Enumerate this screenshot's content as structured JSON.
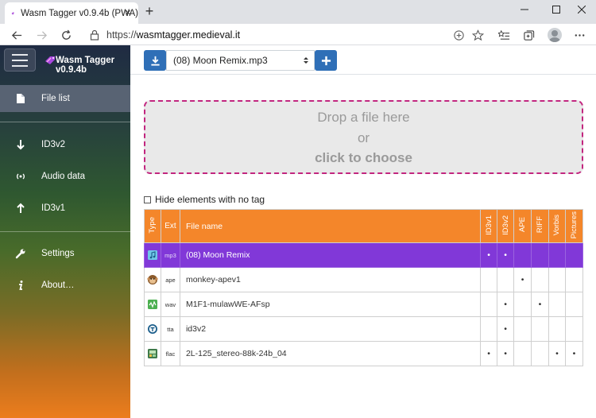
{
  "browser": {
    "tab_title": "Wasm Tagger v0.9.4b (PWA)",
    "url_scheme": "https://",
    "url_host": "wasmtagger.medieval.it"
  },
  "app": {
    "title": "Wasm Tagger v0.9.4b"
  },
  "sidebar": {
    "items": [
      {
        "label": "File list",
        "icon": "file-icon",
        "active": true
      },
      {
        "label": "ID3v2",
        "icon": "arrow-down-icon"
      },
      {
        "label": "Audio data",
        "icon": "broadcast-icon"
      },
      {
        "label": "ID3v1",
        "icon": "arrow-up-icon"
      },
      {
        "label": "Settings",
        "icon": "wrench-icon"
      },
      {
        "label": "About…",
        "icon": "info-icon"
      }
    ]
  },
  "toolbar": {
    "selected_file": "(08) Moon Remix.mp3"
  },
  "dropzone": {
    "line1": "Drop a file here",
    "line2": "or",
    "line3": "click to choose"
  },
  "filter": {
    "hide_label": "Hide elements with no tag",
    "checked": false
  },
  "table": {
    "headers": {
      "type": "Type",
      "ext": "Ext",
      "name": "File name",
      "id3v1": "ID3v1",
      "id3v2": "ID3v2",
      "ape": "APE",
      "riff": "RIFF",
      "vorbis": "Vorbis",
      "pictures": "Pictures"
    },
    "rows": [
      {
        "icon": "music-file-icon",
        "ext": "mp3",
        "name": "(08) Moon Remix",
        "id3v1": "•",
        "id3v2": "•",
        "ape": "",
        "riff": "",
        "vorbis": "",
        "pictures": ""
      },
      {
        "icon": "monkey-icon",
        "ext": "ape",
        "name": "monkey-apev1",
        "id3v1": "",
        "id3v2": "",
        "ape": "•",
        "riff": "",
        "vorbis": "",
        "pictures": ""
      },
      {
        "icon": "wav-file-icon",
        "ext": "wav",
        "name": "M1F1-mulawWE-AFsp",
        "id3v1": "",
        "id3v2": "•",
        "ape": "",
        "riff": "•",
        "vorbis": "",
        "pictures": ""
      },
      {
        "icon": "tta-icon",
        "ext": "tta",
        "name": "id3v2",
        "id3v1": "",
        "id3v2": "•",
        "ape": "",
        "riff": "",
        "vorbis": "",
        "pictures": ""
      },
      {
        "icon": "flac-file-icon",
        "ext": "flac",
        "name": "2L-125_stereo-88k-24b_04",
        "id3v1": "•",
        "id3v2": "•",
        "ape": "",
        "riff": "",
        "vorbis": "•",
        "pictures": "•"
      }
    ]
  }
}
